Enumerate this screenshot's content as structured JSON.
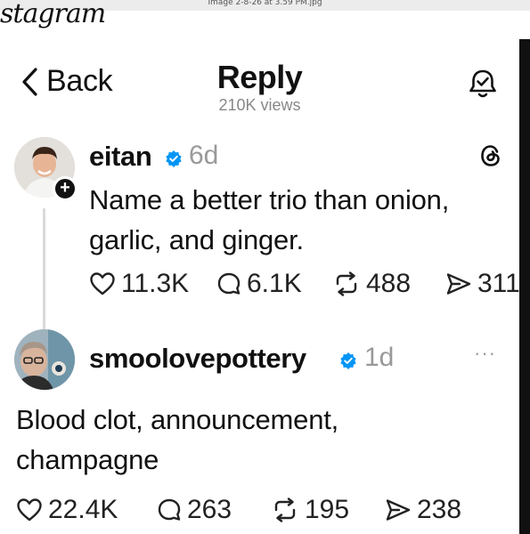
{
  "window": {
    "filename": "Image 2-8-26 at 3.59 PM.jpg"
  },
  "app_strip": {
    "text": "stagram"
  },
  "header": {
    "back_label": "Back",
    "title": "Reply",
    "views": "210K views"
  },
  "posts": [
    {
      "username": "eitan",
      "time": "6d",
      "text_line1": "Name a better trio than onion,",
      "text_line2": "garlic, and ginger.",
      "likes": "11.3K",
      "replies": "6.1K",
      "reposts": "488",
      "shares": "311"
    },
    {
      "username": "smoolovepottery",
      "time": "1d",
      "more": "···",
      "text_line1": "Blood clot, announcement,",
      "text_line2": "champagne",
      "likes": "22.4K",
      "replies": "263",
      "reposts": "195",
      "shares": "238"
    }
  ],
  "colors": {
    "verified": "#0095f6",
    "text": "#111111",
    "muted": "#999999",
    "thread_line": "#d9d9d9"
  },
  "icons": {
    "back": "chevron-left-icon",
    "notify": "bell-check-icon",
    "brand": "threads-logo-icon",
    "like": "heart-icon",
    "reply": "comment-icon",
    "repost": "repost-icon",
    "share": "send-icon",
    "verified": "verified-badge-icon",
    "follow": "plus-icon"
  }
}
